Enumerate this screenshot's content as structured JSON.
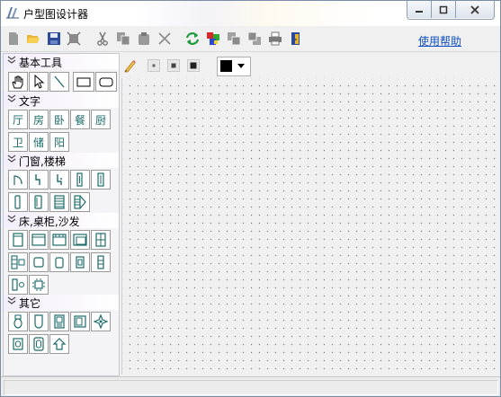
{
  "window": {
    "title": "户型图设计器"
  },
  "toolbar": {
    "help_label": "使用帮助"
  },
  "palette": {
    "sections": [
      {
        "label": "基本工具"
      },
      {
        "label": "文字",
        "items": [
          "厅",
          "房",
          "卧",
          "餐",
          "厨",
          "卫",
          "储",
          "阳"
        ]
      },
      {
        "label": "门窗,楼梯"
      },
      {
        "label": "床,桌柜,沙发"
      },
      {
        "label": "其它"
      }
    ]
  },
  "colors": {
    "current_draw_color": "#000000",
    "icon_teal": "#1e6b6b",
    "link": "#1050c0"
  }
}
